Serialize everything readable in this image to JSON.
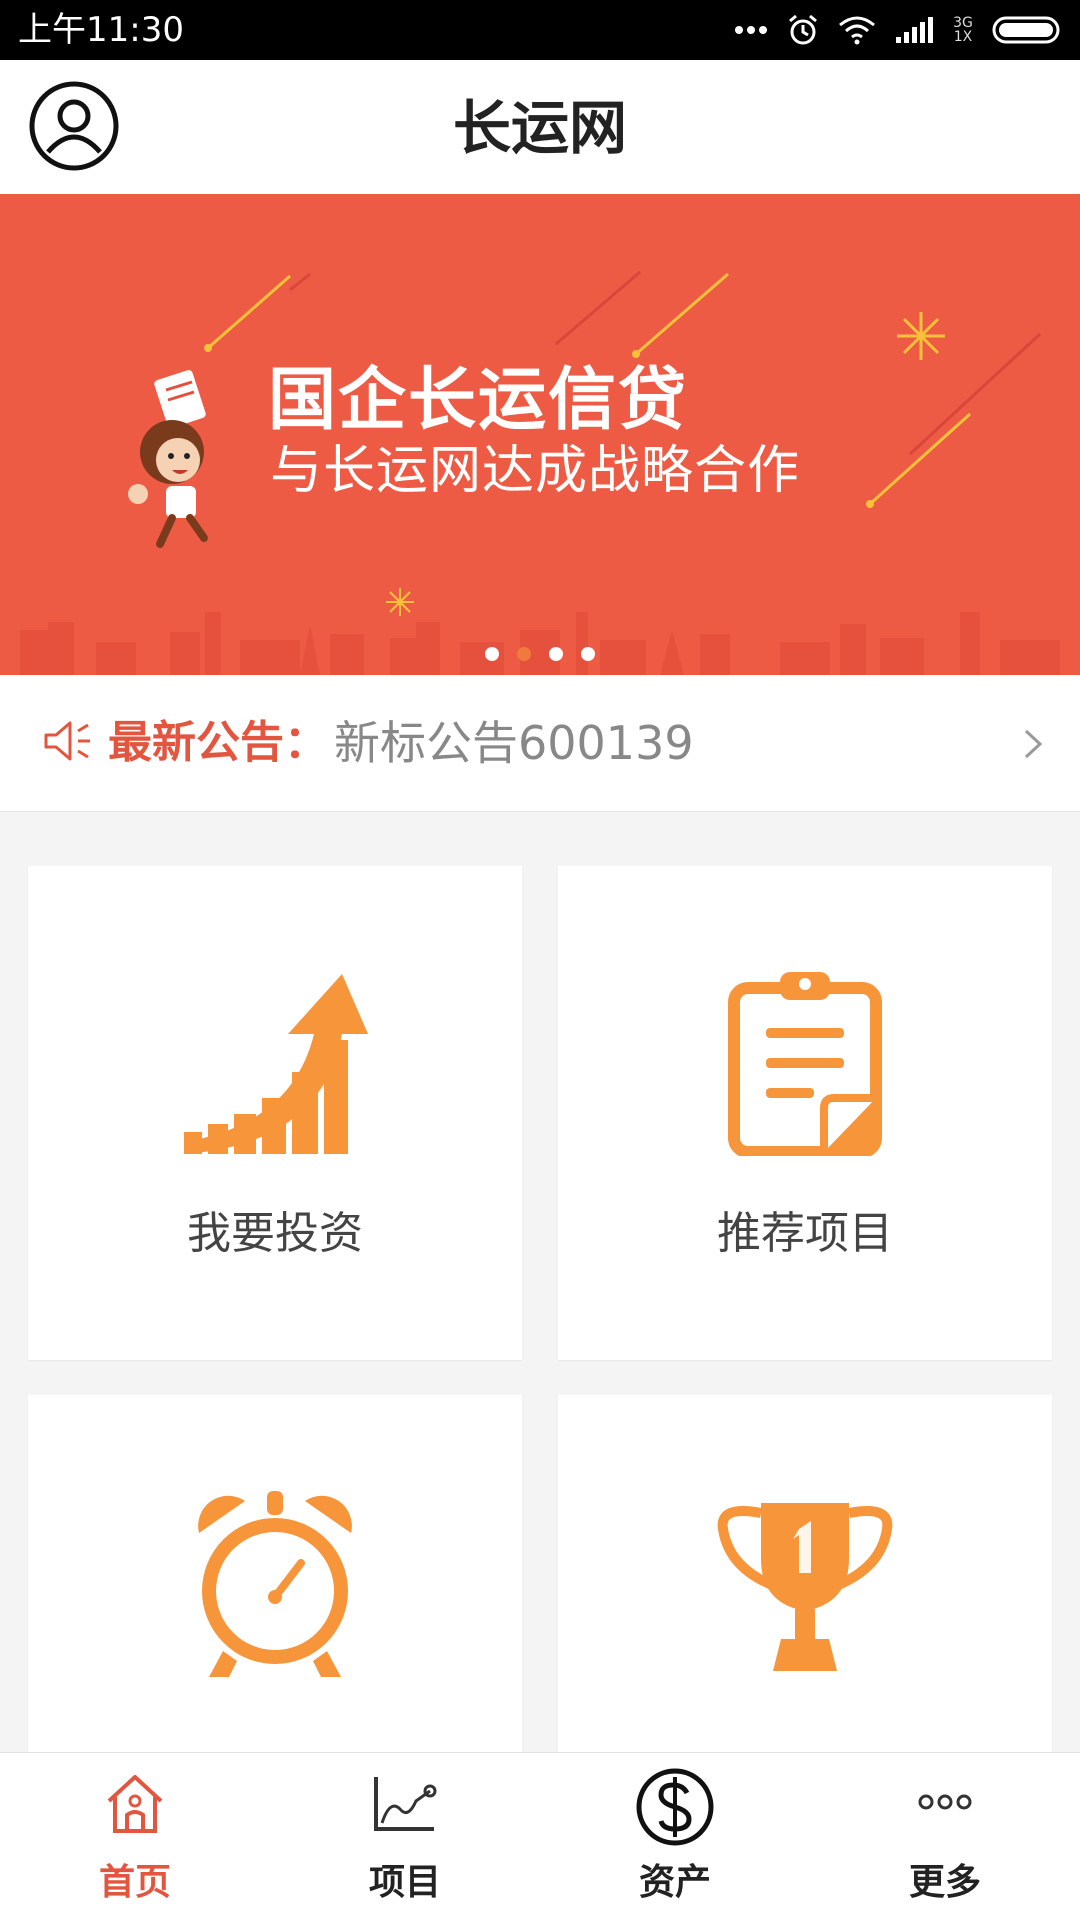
{
  "status_bar": {
    "time": "上午11:30",
    "network_top": "3G",
    "network_bottom": "1X"
  },
  "header": {
    "title": "长运网"
  },
  "banner": {
    "title": "国企长运信贷",
    "subtitle": "与长运网达成战略合作",
    "active_slide": 2,
    "slide_count": 4
  },
  "notice": {
    "label": "最新公告：",
    "text": "新标公告600139"
  },
  "grid": {
    "items": [
      {
        "label": "我要投资",
        "icon": "growth-arrow-icon"
      },
      {
        "label": "推荐项目",
        "icon": "clipboard-icon"
      },
      {
        "label": "",
        "icon": "alarm-clock-icon"
      },
      {
        "label": "",
        "icon": "trophy-icon"
      }
    ]
  },
  "bottom_nav": {
    "items": [
      {
        "label": "首页",
        "icon": "home-icon",
        "active": true
      },
      {
        "label": "项目",
        "icon": "chart-icon",
        "active": false
      },
      {
        "label": "资产",
        "icon": "dollar-icon",
        "active": false
      },
      {
        "label": "更多",
        "icon": "more-icon",
        "active": false
      }
    ]
  },
  "colors": {
    "accent": "#e2553f",
    "banner": "#ee5b45",
    "icon_orange": "#f7953a"
  }
}
